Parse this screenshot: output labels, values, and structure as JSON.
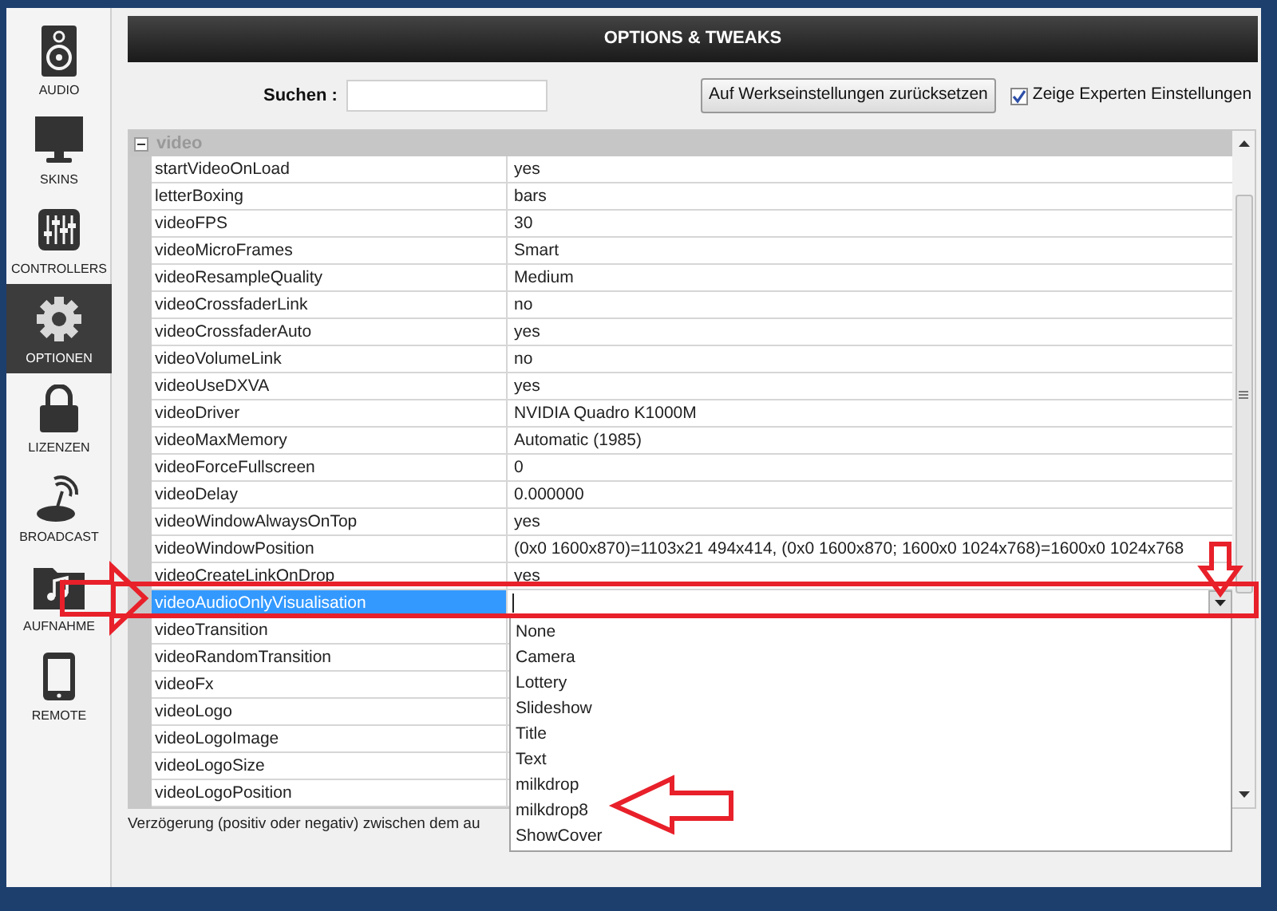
{
  "sidebar": {
    "items": [
      {
        "label": "AUDIO",
        "kind": "speaker",
        "selected": false
      },
      {
        "label": "SKINS",
        "kind": "monitor",
        "selected": false
      },
      {
        "label": "CONTROLLERS",
        "kind": "mixer",
        "selected": false
      },
      {
        "label": "OPTIONEN",
        "kind": "gear",
        "selected": true
      },
      {
        "label": "LIZENZEN",
        "kind": "lock",
        "selected": false
      },
      {
        "label": "BROADCAST",
        "kind": "antenna",
        "selected": false
      },
      {
        "label": "AUFNAHME",
        "kind": "folder",
        "selected": false
      },
      {
        "label": "REMOTE",
        "kind": "tablet",
        "selected": false
      }
    ]
  },
  "header": {
    "title": "OPTIONS & TWEAKS"
  },
  "search": {
    "label": "Suchen :"
  },
  "reset_button": "Auf Werkseinstellungen zurücksetzen",
  "expert_toggle": {
    "label": "Zeige Experten Einstellungen",
    "checked": true
  },
  "group": {
    "title": "video",
    "expanded": true,
    "rows": [
      {
        "name": "startVideoOnLoad",
        "value": "yes",
        "selected": false
      },
      {
        "name": "letterBoxing",
        "value": "bars",
        "selected": false
      },
      {
        "name": "videoFPS",
        "value": "30",
        "selected": false
      },
      {
        "name": "videoMicroFrames",
        "value": "Smart",
        "selected": false
      },
      {
        "name": "videoResampleQuality",
        "value": "Medium",
        "selected": false
      },
      {
        "name": "videoCrossfaderLink",
        "value": "no",
        "selected": false
      },
      {
        "name": "videoCrossfaderAuto",
        "value": "yes",
        "selected": false
      },
      {
        "name": "videoVolumeLink",
        "value": "no",
        "selected": false
      },
      {
        "name": "videoUseDXVA",
        "value": "yes",
        "selected": false
      },
      {
        "name": "videoDriver",
        "value": "NVIDIA Quadro K1000M",
        "selected": false
      },
      {
        "name": "videoMaxMemory",
        "value": "Automatic (1985)",
        "selected": false
      },
      {
        "name": "videoForceFullscreen",
        "value": "0",
        "selected": false
      },
      {
        "name": "videoDelay",
        "value": "0.000000",
        "selected": false
      },
      {
        "name": "videoWindowAlwaysOnTop",
        "value": "yes",
        "selected": false
      },
      {
        "name": "videoWindowPosition",
        "value": "(0x0 1600x870)=1103x21 494x414, (0x0 1600x870; 1600x0 1024x768)=1600x0 1024x768",
        "selected": false
      },
      {
        "name": "videoCreateLinkOnDrop",
        "value": "yes",
        "selected": false
      },
      {
        "name": "videoAudioOnlyVisualisation",
        "selected": true
      },
      {
        "name": "videoTransition",
        "selected": false
      },
      {
        "name": "videoRandomTransition",
        "selected": false
      },
      {
        "name": "videoFx",
        "selected": false
      },
      {
        "name": "videoLogo",
        "selected": false
      },
      {
        "name": "videoLogoImage",
        "selected": false
      },
      {
        "name": "videoLogoSize",
        "selected": false
      },
      {
        "name": "videoLogoPosition",
        "selected": false
      }
    ]
  },
  "dropdown": {
    "options": [
      "None",
      "Camera",
      "Lottery",
      "Slideshow",
      "Title",
      "Text",
      "milkdrop",
      "milkdrop8",
      "ShowCover"
    ]
  },
  "status_text": "Verzögerung (positiv oder negativ) zwischen dem au"
}
